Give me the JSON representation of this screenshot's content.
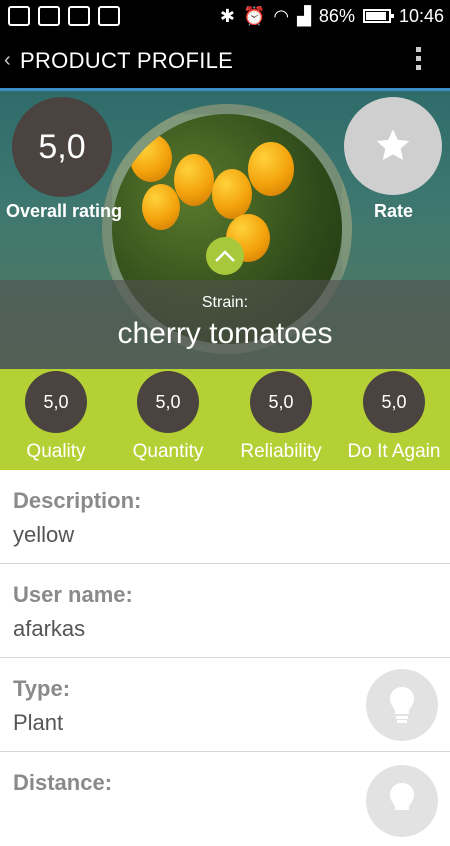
{
  "status_bar": {
    "battery_percent": "86%",
    "time": "10:46"
  },
  "action_bar": {
    "title": "PRODUCT PROFILE"
  },
  "hero": {
    "overall_rating": "5,0",
    "overall_label": "Overall rating",
    "rate_label": "Rate",
    "strain_label": "Strain:",
    "strain_name": "cherry tomatoes"
  },
  "ratings": [
    {
      "value": "5,0",
      "label": "Quality"
    },
    {
      "value": "5,0",
      "label": "Quantity"
    },
    {
      "value": "5,0",
      "label": "Reliability"
    },
    {
      "value": "5,0",
      "label": "Do It Again"
    }
  ],
  "details": {
    "description": {
      "label": "Description:",
      "value": "yellow"
    },
    "user": {
      "label": "User name:",
      "value": "afarkas"
    },
    "type": {
      "label": "Type:",
      "value": "Plant"
    },
    "distance": {
      "label": "Distance:"
    }
  },
  "colors": {
    "accent_green": "#b5d035",
    "rating_circle": "#4a433f",
    "action_bar_underline": "#3b8ec8"
  },
  "icons": [
    "back-chevron-icon",
    "overflow-menu-icon",
    "star-icon",
    "chevron-up-icon",
    "lightbulb-icon"
  ]
}
